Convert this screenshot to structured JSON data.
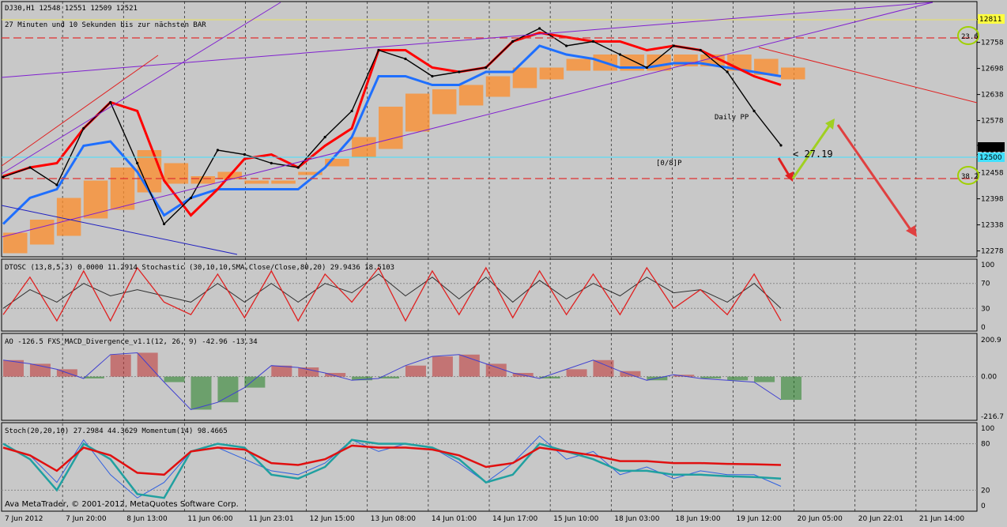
{
  "main": {
    "symbol_line": "DJ30,H1  12548 12551 12509 12521",
    "countdown": "27 Minuten und 10 Sekunden bis zur nächsten BAR",
    "daily_pp_label": "Daily PP",
    "pp_label": "[0/8]P",
    "arrow_label": "< 27.19",
    "fib_top": "23.6",
    "fib_bottom": "38.2",
    "price_tag_current": "12521",
    "price_tag_cyan": "12500",
    "price_tag_yellow": "12811"
  },
  "indicators": {
    "dtosc_header": "DTOSC (13,8,5,3) 0.0000 11.2914  Stochastic (30,10,10,SMA,Close/Close,80,20) 29.9436 18.5103",
    "macd_header": "AO -126.5  FXS_MACD_Divergence_v1.1(12, 26, 9) -42.96 -13.34",
    "stoch_header": "Stoch(20,20,10) 27.2984 44.3629  Momentum(14) 98.4665"
  },
  "footer": {
    "copyright": "Ava MetaTrader, © 2001-2012, MetaQuotes Software Corp."
  },
  "colors": {
    "bg": "#c8c8c8",
    "grid": "#000000",
    "tenkan": "#ff0000",
    "kijun": "#1e6fff",
    "cloud": "#ff8c28",
    "fibline": "#e03030",
    "stoch_main": "#e02020",
    "stoch_sig": "#2020e0",
    "macd_pos": "#c03030",
    "macd_neg": "#208020",
    "stoch2_main": "#e01010",
    "stoch2_sig": "#20a0a0"
  },
  "chart_data": [
    {
      "type": "line",
      "name": "main",
      "title": "DJ30,H1",
      "x": [
        "7 Jun 2012",
        "7 Jun 20:00",
        "8 Jun 13:00",
        "11 Jun 06:00",
        "11 Jun 23:01",
        "12 Jun 15:00",
        "13 Jun 08:00",
        "14 Jun 01:00",
        "14 Jun 17:00",
        "15 Jun 10:00",
        "18 Jun 03:00",
        "18 Jun 19:00",
        "19 Jun 12:00",
        "20 Jun 05:00",
        "20 Jun 22:01",
        "21 Jun 14:00"
      ],
      "yticks": [
        "12811",
        "12758",
        "12698",
        "12638",
        "12578",
        "12521",
        "12500",
        "12458",
        "12398",
        "12338",
        "12278"
      ],
      "ylim": [
        12270,
        12830
      ],
      "close": [
        12448,
        12470,
        12430,
        12560,
        12620,
        12480,
        12340,
        12400,
        12510,
        12500,
        12480,
        12470,
        12540,
        12600,
        12740,
        12720,
        12680,
        12690,
        12700,
        12760,
        12790,
        12750,
        12760,
        12730,
        12700,
        12750,
        12740,
        12690,
        12600,
        12521
      ],
      "tenkan": [
        12450,
        12470,
        12480,
        12560,
        12620,
        12600,
        12440,
        12360,
        12420,
        12490,
        12500,
        12470,
        12520,
        12560,
        12740,
        12740,
        12700,
        12690,
        12700,
        12760,
        12780,
        12770,
        12760,
        12760,
        12740,
        12750,
        12740,
        12710,
        12680,
        12660
      ],
      "kijun": [
        12340,
        12400,
        12420,
        12520,
        12530,
        12460,
        12360,
        12400,
        12420,
        12420,
        12420,
        12420,
        12470,
        12540,
        12680,
        12680,
        12660,
        12660,
        12690,
        12690,
        12750,
        12730,
        12720,
        12700,
        12700,
        12710,
        12710,
        12700,
        12690,
        12680
      ],
      "cloud_top": [
        12320,
        12350,
        12400,
        12440,
        12470,
        12510,
        12480,
        12450,
        12460,
        12440,
        12440,
        12460,
        12490,
        12540,
        12610,
        12640,
        12650,
        12660,
        12680,
        12700,
        12700,
        12720,
        12730,
        12730,
        12730,
        12730,
        12730,
        12730,
        12720,
        12700
      ],
      "cloud_bot": [
        12280,
        12300,
        12320,
        12360,
        12380,
        12420,
        12440,
        12440,
        12450,
        12440,
        12440,
        12460,
        12480,
        12500,
        12520,
        12560,
        12600,
        12620,
        12640,
        12660,
        12680,
        12700,
        12700,
        12700,
        12700,
        12710,
        12710,
        12700,
        12690,
        12680
      ]
    },
    {
      "type": "line",
      "name": "stochastic_dtosc",
      "ylim": [
        0,
        100
      ],
      "yticks": [
        "100",
        "70",
        "30",
        "0"
      ],
      "series": [
        {
          "name": "DTOSC",
          "values": [
            20,
            80,
            10,
            90,
            10,
            95,
            40,
            20,
            85,
            15,
            90,
            10,
            85,
            40,
            95,
            10,
            90,
            20,
            95,
            15,
            90,
            20,
            85,
            20,
            95,
            30,
            60,
            20,
            85,
            10
          ]
        },
        {
          "name": "Stochastic",
          "values": [
            30,
            60,
            40,
            70,
            50,
            60,
            50,
            40,
            70,
            40,
            70,
            40,
            70,
            55,
            85,
            50,
            80,
            45,
            80,
            40,
            75,
            45,
            70,
            50,
            80,
            55,
            60,
            40,
            70,
            30
          ]
        }
      ]
    },
    {
      "type": "bar",
      "name": "macd",
      "ylim": [
        -216.7,
        200.9
      ],
      "yticks": [
        "200.9",
        "0.00",
        "-216.7"
      ],
      "values": [
        90,
        70,
        40,
        -10,
        120,
        130,
        -30,
        -180,
        -140,
        -60,
        60,
        50,
        20,
        -20,
        -10,
        60,
        110,
        120,
        70,
        20,
        -10,
        40,
        90,
        30,
        -20,
        10,
        -10,
        -20,
        -30,
        -126.5
      ]
    },
    {
      "type": "line",
      "name": "stoch_momentum",
      "ylim": [
        0,
        100
      ],
      "yticks": [
        "100",
        "80",
        "20",
        "0"
      ],
      "series": [
        {
          "name": "Stoch",
          "values": [
            80,
            60,
            20,
            80,
            60,
            15,
            10,
            70,
            80,
            75,
            40,
            35,
            50,
            85,
            80,
            80,
            75,
            60,
            30,
            40,
            80,
            70,
            60,
            45,
            45,
            40,
            40,
            38,
            37,
            35
          ]
        },
        {
          "name": "Momentum",
          "values": [
            75,
            65,
            30,
            85,
            40,
            10,
            30,
            70,
            75,
            60,
            45,
            40,
            55,
            85,
            70,
            80,
            75,
            55,
            30,
            55,
            90,
            60,
            70,
            40,
            50,
            35,
            45,
            40,
            40,
            25
          ]
        }
      ]
    }
  ]
}
